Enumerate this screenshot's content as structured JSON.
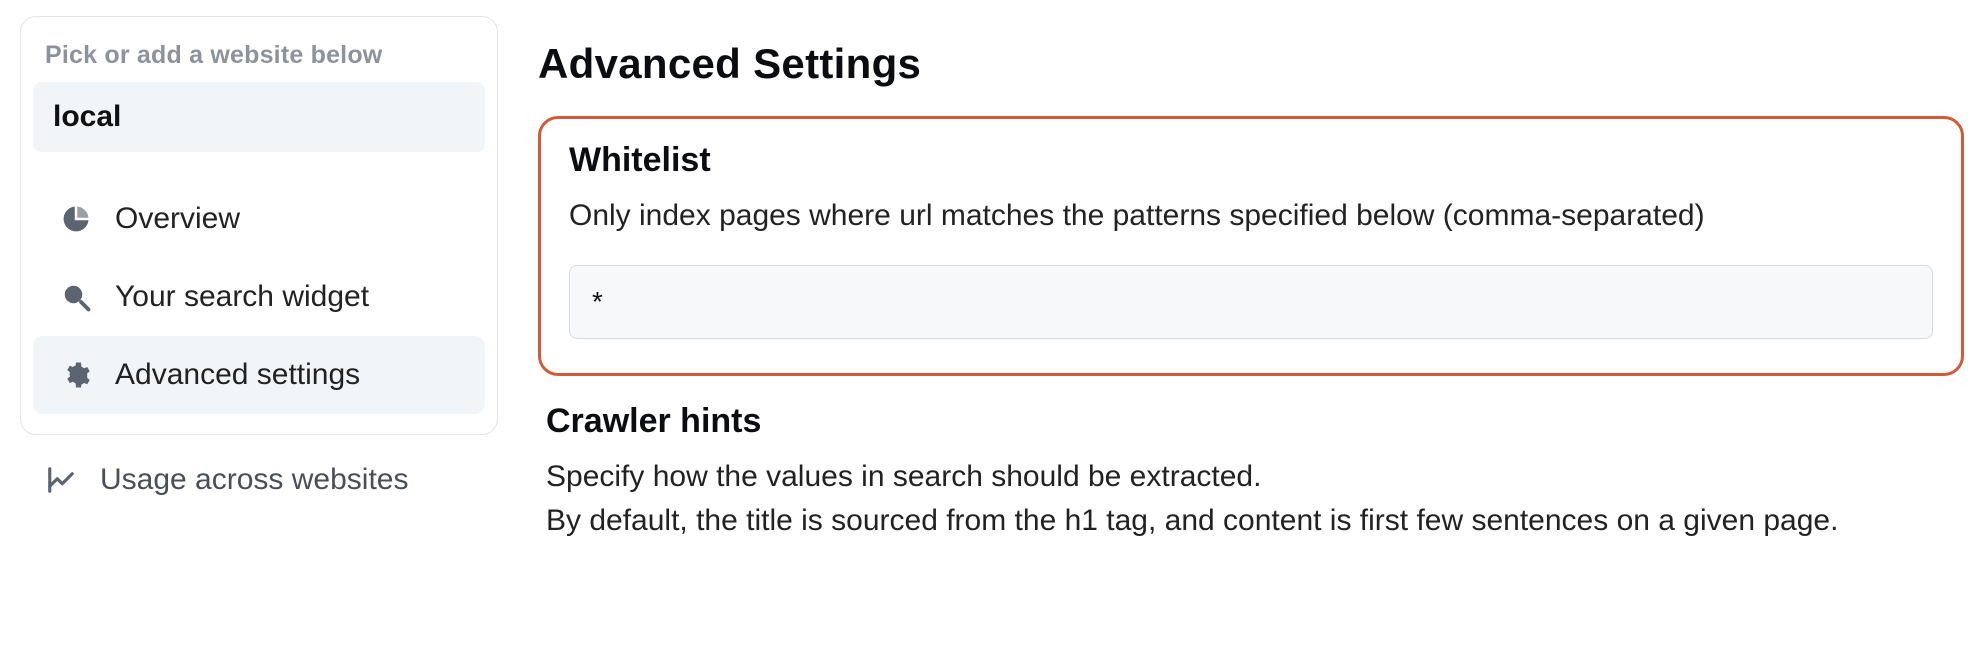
{
  "sidebar": {
    "hint": "Pick or add a website below",
    "websites": [
      {
        "label": "local"
      }
    ],
    "nav": [
      {
        "icon": "pie-chart-icon",
        "label": "Overview",
        "active": false
      },
      {
        "icon": "search-icon",
        "label": "Your search widget",
        "active": false
      },
      {
        "icon": "gear-icon",
        "label": "Advanced settings",
        "active": true
      }
    ]
  },
  "bottom_link": {
    "icon": "line-chart-icon",
    "label": "Usage across websites"
  },
  "main": {
    "title": "Advanced Settings",
    "whitelist": {
      "heading": "Whitelist",
      "description": "Only index pages where url matches the patterns specified below (comma-separated)",
      "value": "*"
    },
    "crawler_hints": {
      "heading": "Crawler hints",
      "description_line1": "Specify how the values in search should be extracted.",
      "description_line2": "By default, the title is sourced from the h1 tag, and content is first few sentences on a given page."
    }
  }
}
